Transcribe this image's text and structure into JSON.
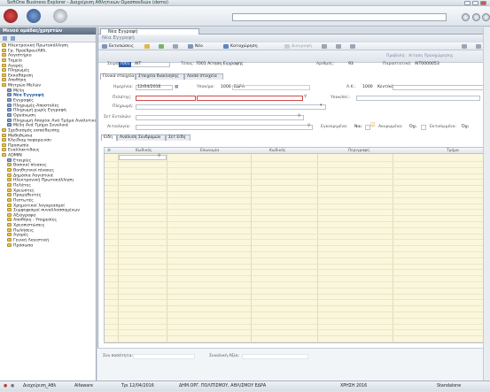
{
  "window": {
    "title": "SoftOne Business Explorer - Διαχείριση Αθλητικών Ομοσπονδιών (demo)"
  },
  "sidebar": {
    "title": "Μενού ομάδας/χρηστών",
    "items": [
      {
        "label": "Ηλεκτρονική Πρωτοκόλληση",
        "type": "folder",
        "indent": 0
      },
      {
        "label": "Γρ. Προέδρου/Αθλ.",
        "type": "folder",
        "indent": 0
      },
      {
        "label": "Λογιστήριο",
        "type": "folder",
        "indent": 0
      },
      {
        "label": "Ταμείο",
        "type": "folder",
        "indent": 0
      },
      {
        "label": "Αγορές",
        "type": "folder",
        "indent": 0
      },
      {
        "label": "Πληρωμές",
        "type": "folder",
        "indent": 0
      },
      {
        "label": "Εκκαθάριση",
        "type": "folder",
        "indent": 0
      },
      {
        "label": "Αποθήκη",
        "type": "folder",
        "indent": 0
      },
      {
        "label": "Μητρώο Μελών",
        "type": "folder",
        "indent": 0
      },
      {
        "label": "Μέλη",
        "type": "page",
        "indent": 1
      },
      {
        "label": "Νέα Εγγραφή",
        "type": "page",
        "indent": 1,
        "bold": true
      },
      {
        "label": "Εγγραφές",
        "type": "page",
        "indent": 1
      },
      {
        "label": "Πληρωμές-Αποστολές",
        "type": "page",
        "indent": 1
      },
      {
        "label": "Πληρωμή χωρίς Εγγραφή",
        "type": "page",
        "indent": 1
      },
      {
        "label": "Οργάνωση",
        "type": "page",
        "indent": 1
      },
      {
        "label": "Πληρωμή Απορίαι Ανά Τμήμα Αναλυτικά",
        "type": "page",
        "indent": 1
      },
      {
        "label": "Μέλη Ανά Τμήμα Συνολικά",
        "type": "page",
        "indent": 1
      },
      {
        "label": "Σχεδιασμός εκπαίδευσης",
        "type": "folder",
        "indent": 0
      },
      {
        "label": "Μαθηθώσια",
        "type": "folder",
        "indent": 0
      },
      {
        "label": "Κλειδιαμ πυφορεινσυ",
        "type": "folder",
        "indent": 0
      },
      {
        "label": "Προσωπίο",
        "type": "folder",
        "indent": 0
      },
      {
        "label": "Εναλλακτιδους",
        "type": "folder",
        "indent": 0
      },
      {
        "label": "ADMIN",
        "type": "folder",
        "indent": 0
      },
      {
        "label": "Εταιρίες",
        "type": "page",
        "indent": 1
      },
      {
        "label": "Βασικοί πίνακες",
        "type": "folder",
        "indent": 1
      },
      {
        "label": "Βοηθητικοί πίνακες",
        "type": "folder",
        "indent": 1
      },
      {
        "label": "Δημόσια Λογιστικά",
        "type": "folder",
        "indent": 1
      },
      {
        "label": "Ηλεκτρονική Πρωτοκόλληση",
        "type": "folder",
        "indent": 1
      },
      {
        "label": "Πελάτες",
        "type": "folder",
        "indent": 1
      },
      {
        "label": "Χρεώστες",
        "type": "folder",
        "indent": 1
      },
      {
        "label": "Προμηθευτές",
        "type": "folder",
        "indent": 1
      },
      {
        "label": "Πιστωτές",
        "type": "folder",
        "indent": 1
      },
      {
        "label": "Χρηματικοί λογαριασμοί",
        "type": "folder",
        "indent": 1
      },
      {
        "label": "Συμφηφισμοί συναλλασσομένων",
        "type": "folder",
        "indent": 1
      },
      {
        "label": "Αξιόγραφα",
        "type": "folder",
        "indent": 1
      },
      {
        "label": "Αποθήκη - Υπηρεσίες",
        "type": "folder",
        "indent": 1
      },
      {
        "label": "Χρεοπιστώσεις",
        "type": "folder",
        "indent": 1
      },
      {
        "label": "Πωλήσεις",
        "type": "folder",
        "indent": 1
      },
      {
        "label": "Αγορές",
        "type": "folder",
        "indent": 1
      },
      {
        "label": "Γενική Λογιστική",
        "type": "folder",
        "indent": 1
      },
      {
        "label": "Πρόσωπα",
        "type": "folder",
        "indent": 1
      }
    ]
  },
  "document_tab": {
    "label": "Νέα Εγγραφή"
  },
  "header": {
    "title": "Νέα Εγγραφή"
  },
  "toolbar": {
    "export": "Εκτυπώσεις",
    "new": "Νέο",
    "save": "Καταχώρηση",
    "delete": "Διαγραφή"
  },
  "banner": {
    "view": "Προβολή : Αίτηση Προσχώρησης",
    "series_label": "Σειρά:",
    "series_code": "7001",
    "series_name": "ΑΙΤ",
    "type_label": "Τύπος:",
    "type_value": "7001  Αίτηση Εγγραφής",
    "number_label": "Αριθμός:",
    "number_value": "93",
    "doc_label": "Παραστατικό:",
    "doc_value": "ΑΙΤ0000053"
  },
  "tabs": {
    "main": "Γενικά στοιχεία",
    "payment": "Στοιχεία διακίνησης",
    "other": "Λοιπά στοιχεία"
  },
  "form": {
    "date_label": "Ημερ/νία:",
    "date_value": "12/04/2016",
    "branch_label": "Υποκ/μα:",
    "branch_code": "1000",
    "branch_name": "ΕΔΡΑ",
    "ak_label": "Α.Κ.:",
    "ak_code": "1000",
    "ak_name": "Κεντ/κό",
    "client_label": "Πελάτης:",
    "client_sub_label": "Υποκ/σεί.:",
    "payment_label": "Πληρωμή:",
    "entry_label": "Σετ Εντολών:",
    "reason_label": "Αιτιολογία:",
    "approved_label": "Εγκεκριμένο:",
    "approved_value": "Ναι",
    "cancelled_label": "Ακυρωμένο:",
    "cancelled_value": "Όχι",
    "printed_label": "Εκτυπωμένο:",
    "printed_value": "Όχι"
  },
  "inner_tabs": [
    "Είδη",
    "Ανάλυση Συνδρομών",
    "Σετ Είδη"
  ],
  "grid": {
    "columns": [
      "Κωδικός",
      "Επωνυμία",
      "Κωδικός",
      "Περιγραφή",
      "Τμήμα"
    ]
  },
  "footer": {
    "total_qty_label": "Συν.ποσότητα:",
    "total_value_label": "Συνολική Αξία:"
  },
  "statusbar": {
    "app": "Διαχείριση_Αθλ",
    "user": "Alfaware",
    "date": "Τρι 12/04/2016",
    "company": "ΔΗΜ.ΟΡΓ. ΠΟΛΙΤΙΣΜΟΥ, ΑΘΛ/ΣΜΟΥ  ΕΔΡΑ",
    "fiscal": "ΧΡΗΣΗ 2016",
    "mode": "Standalone"
  }
}
